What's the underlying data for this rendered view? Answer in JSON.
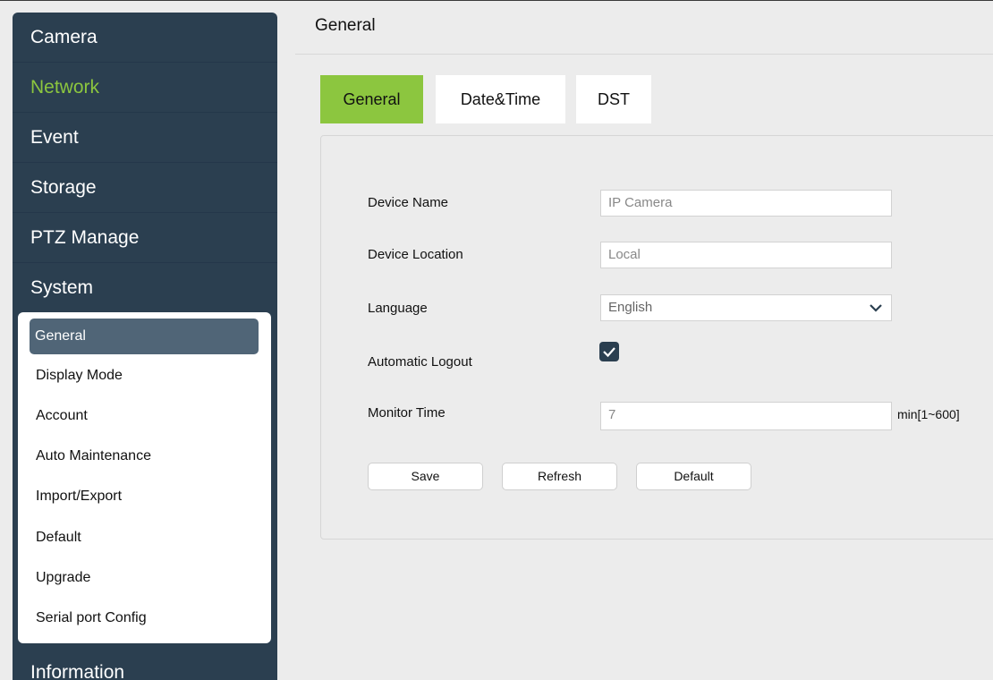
{
  "sidebar": {
    "menu": [
      {
        "label": "Camera"
      },
      {
        "label": "Network"
      },
      {
        "label": "Event"
      },
      {
        "label": "Storage"
      },
      {
        "label": "PTZ Manage"
      },
      {
        "label": "System"
      },
      {
        "label": "Information"
      }
    ],
    "active_menu": "Network",
    "submenu": [
      {
        "label": "General"
      },
      {
        "label": "Display Mode"
      },
      {
        "label": "Account"
      },
      {
        "label": "Auto Maintenance"
      },
      {
        "label": "Import/Export"
      },
      {
        "label": "Default"
      },
      {
        "label": "Upgrade"
      },
      {
        "label": "Serial port Config"
      }
    ],
    "active_submenu": "General"
  },
  "main": {
    "title": "General",
    "tabs": [
      {
        "label": "General"
      },
      {
        "label": "Date&Time"
      },
      {
        "label": "DST"
      }
    ],
    "active_tab": "General",
    "form": {
      "device_name": {
        "label": "Device Name",
        "placeholder": "IP Camera"
      },
      "device_location": {
        "label": "Device Location",
        "placeholder": "Local"
      },
      "language": {
        "label": "Language",
        "value": "English"
      },
      "automatic_logout": {
        "label": "Automatic Logout",
        "checked": true
      },
      "monitor_time": {
        "label": "Monitor Time",
        "value": "7",
        "unit": "min[1~600]"
      }
    },
    "buttons": {
      "save": "Save",
      "refresh": "Refresh",
      "default": "Default"
    }
  },
  "colors": {
    "sidebar_bg": "#2b3f50",
    "accent_green": "#8cc63f",
    "submenu_active_bg": "#506577",
    "page_bg": "#ececec"
  },
  "icons": {
    "language_dropdown": "chevron-down-icon",
    "logout_checkbox": "checkmark-icon"
  }
}
